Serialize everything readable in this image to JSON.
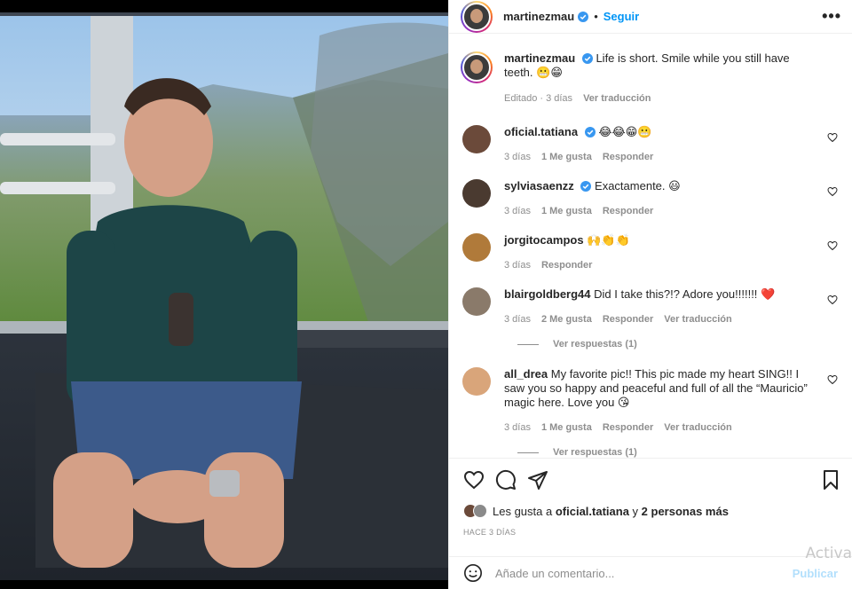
{
  "post": {
    "username": "martinezmau",
    "follow_label": "Seguir",
    "more_label": "•••",
    "caption": "Life is short. Smile while you still have teeth. 😬😁",
    "caption_meta_edited": "Editado · 3 días",
    "caption_meta_translate": "Ver traducción"
  },
  "comments": [
    {
      "user": "oficial.tatiana",
      "verified": true,
      "text": "😂😂😁😬",
      "time": "3 días",
      "likes": "1 Me gusta",
      "reply": "Responder",
      "translate": "",
      "avatar_color": "#6b4a3a"
    },
    {
      "user": "sylviasaenzz",
      "verified": true,
      "text": "Exactamente. 😃",
      "time": "3 días",
      "likes": "1 Me gusta",
      "reply": "Responder",
      "translate": "",
      "avatar_color": "#4a3a30"
    },
    {
      "user": "jorgitocampos",
      "verified": false,
      "text": "🙌👏👏",
      "time": "3 días",
      "likes": "",
      "reply": "Responder",
      "translate": "",
      "avatar_color": "#b07a3a"
    },
    {
      "user": "blairgoldberg44",
      "verified": false,
      "text": "Did I take this?!? Adore you!!!!!!! ❤️",
      "time": "3 días",
      "likes": "2 Me gusta",
      "reply": "Responder",
      "translate": "Ver traducción",
      "avatar_color": "#8a7a6a",
      "replies": "Ver respuestas (1)"
    },
    {
      "user": "all_drea",
      "verified": false,
      "text": "My favorite pic!! This pic made my heart SING!! I saw you so happy and peaceful and full of all the “Mauricio” magic here. Love you 😘",
      "time": "3 días",
      "likes": "1 Me gusta",
      "reply": "Responder",
      "translate": "Ver traducción",
      "avatar_color": "#d9a57a",
      "replies": "Ver respuestas (1)"
    }
  ],
  "likes": {
    "prefix": "Les gusta a",
    "user": "oficial.tatiana",
    "joiner": "y",
    "others": "2 personas más"
  },
  "time_ago": "HACE 3 DÍAS",
  "add_comment": {
    "placeholder": "Añade un comentario...",
    "publish": "Publicar"
  },
  "watermark": "Activa",
  "colors": {
    "accent": "#0095f6",
    "verified": "#3897f0",
    "heart_red": "#ed4956"
  },
  "icons": [
    "heart-icon",
    "comment-icon",
    "share-icon",
    "bookmark-icon",
    "smile-icon",
    "verified-icon",
    "more-icon"
  ]
}
